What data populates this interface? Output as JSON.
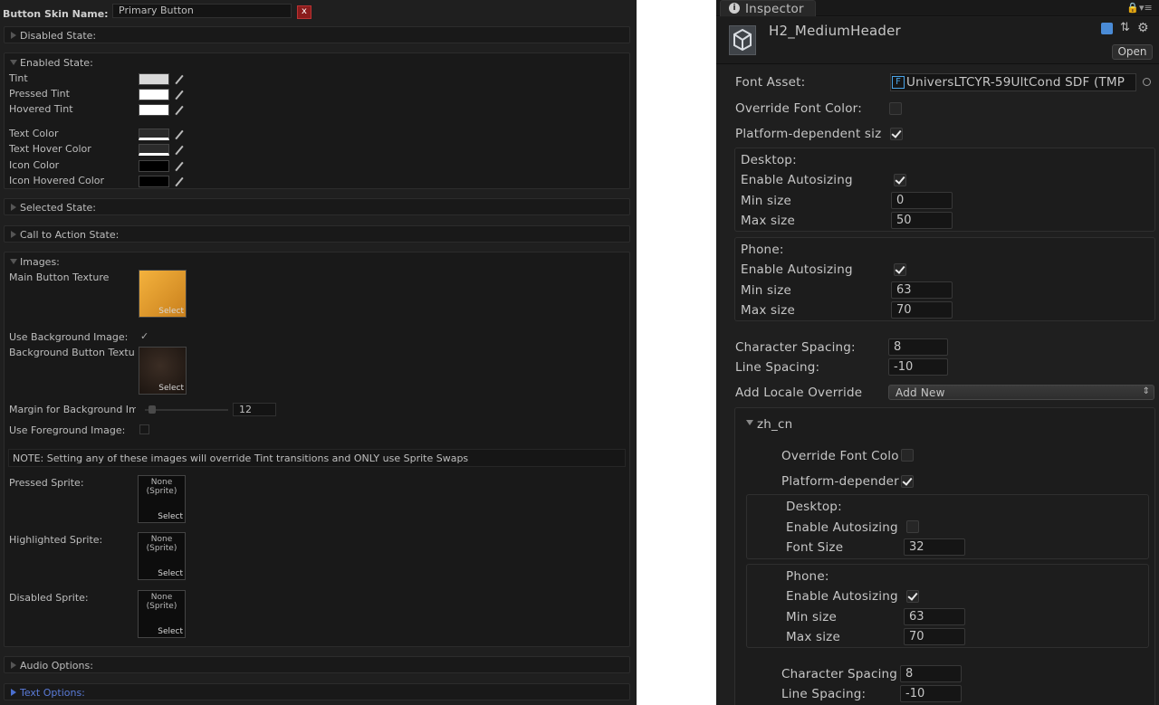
{
  "left": {
    "skin_name_label": "Button Skin Name:",
    "skin_name_value": "Primary Button",
    "close_label": "x",
    "sections": {
      "disabled": "Disabled State:",
      "enabled": "Enabled State:",
      "selected": "Selected State:",
      "cta": "Call to Action State:",
      "images": "Images:",
      "audio": "Audio Options:",
      "text": "Text Options:"
    },
    "enabled": {
      "tint": "Tint",
      "pressed_tint": "Pressed Tint",
      "hovered_tint": "Hovered Tint",
      "text_color": "Text Color",
      "text_hover_color": "Text Hover Color",
      "icon_color": "Icon Color",
      "icon_hovered_color": "Icon Hovered Color"
    },
    "images": {
      "main_texture": "Main Button Texture",
      "use_bg": "Use Background Image:",
      "bg_texture": "Background Button Textu",
      "margin": "Margin for Background Im",
      "margin_value": "12",
      "use_fg": "Use Foreground Image:",
      "note": "NOTE: Setting any of these images will override Tint transitions and ONLY use Sprite Swaps",
      "pressed": "Pressed Sprite:",
      "highlighted": "Highlighted Sprite:",
      "disabled": "Disabled Sprite:",
      "none_line1": "None",
      "none_line2": "(Sprite)",
      "select": "Select"
    },
    "colors": {
      "accent_text": "#5a7bd8",
      "orange": "#e8a23a",
      "close_bg": "#8a1c1c"
    }
  },
  "right": {
    "tab": "Inspector",
    "asset_name": "H2_MediumHeader",
    "open_button": "Open",
    "font_asset_label": "Font Asset:",
    "font_asset_value": "UniversLTCYR-59UltCond SDF (TMP",
    "override_font_color": "Override Font Color:",
    "platform_dependent": "Platform-dependent siz",
    "desktop": "Desktop:",
    "phone": "Phone:",
    "enable_autosizing": "Enable Autosizing",
    "min_size": "Min size",
    "max_size": "Max size",
    "desktop_min": "0",
    "desktop_max": "50",
    "phone_min": "63",
    "phone_max": "70",
    "character_spacing": "Character Spacing:",
    "character_spacing_value": "8",
    "line_spacing": "Line Spacing:",
    "line_spacing_value": "-10",
    "add_locale_override": "Add Locale Override",
    "add_new": "Add New",
    "locale": "zh_cn",
    "override_font_color_short": "Override Font Colo",
    "platform_dependent_short": "Platform-depender",
    "font_size": "Font Size",
    "zh_desktop_font_size": "32",
    "zh_phone_min": "63",
    "zh_phone_max": "70",
    "zh_character_spacing": "Character Spacing",
    "zh_character_spacing_value": "8",
    "zh_line_spacing": "Line Spacing:",
    "zh_line_spacing_value": "-10"
  }
}
